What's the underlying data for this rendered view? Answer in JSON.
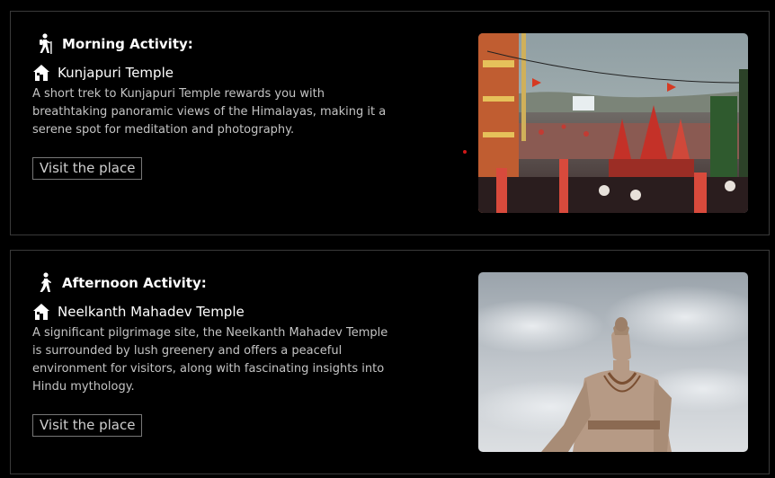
{
  "activities": [
    {
      "heading": "Morning Activity:",
      "place": "Kunjapuri Temple",
      "description": "A short trek to Kunjapuri Temple rewards you with breathtaking panoramic views of the Himalayas, making it a serene spot for meditation and photography.",
      "button_label": "Visit the place",
      "heading_icon": "hiking-person-icon",
      "place_icon": "house-icon"
    },
    {
      "heading": "Afternoon Activity:",
      "place": "Neelkanth Mahadev Temple",
      "description": "A significant pilgrimage site, the Neelkanth Mahadev Temple is surrounded by lush greenery and offers a peaceful environment for visitors, along with fascinating insights into Hindu mythology.",
      "button_label": "Visit the place",
      "heading_icon": "walking-person-icon",
      "place_icon": "house-icon"
    }
  ],
  "colors": {
    "background": "#000000",
    "border": "#3a3a3a",
    "text": "#ffffff",
    "muted_text": "#c4c4c4",
    "accent_dot": "#d01818"
  }
}
